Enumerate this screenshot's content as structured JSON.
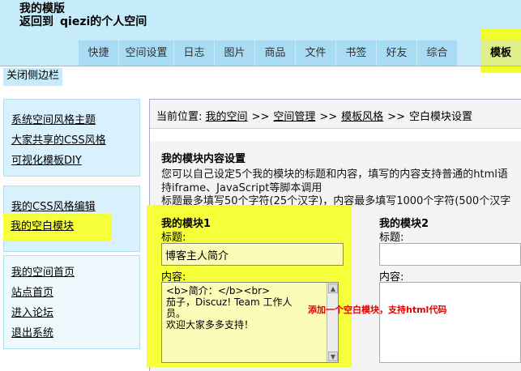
{
  "header": {
    "title": "我的模版",
    "back_prefix": "返回到",
    "back_user": "qiezi的个人空间"
  },
  "tabs": [
    {
      "label": "快捷",
      "width": 50
    },
    {
      "label": "空间设置",
      "width": 68
    },
    {
      "label": "日志",
      "width": 50
    },
    {
      "label": "图片",
      "width": 50
    },
    {
      "label": "商品",
      "width": 50
    },
    {
      "label": "文件",
      "width": 50
    },
    {
      "label": "书签",
      "width": 50
    },
    {
      "label": "好友",
      "width": 50
    },
    {
      "label": "综合",
      "width": 50
    }
  ],
  "active_tab": "模板",
  "close_sidebar": "关闭侧边栏",
  "sidebar": {
    "group1": [
      "系统空间风格主题",
      "大家共享的CSS风格",
      "可视化模板DIY"
    ],
    "group2": [
      "我的CSS风格编辑",
      "我的空白模块"
    ],
    "group3": [
      "我的空间首页",
      "站点首页",
      "进入论坛",
      "退出系统"
    ]
  },
  "breadcrumb": {
    "prefix": "当前位置:",
    "items": [
      "我的空间",
      "空间管理",
      "模板风格"
    ],
    "current": "空白模块设置",
    "sep": ">>"
  },
  "content": {
    "title": "我的模块内容设置",
    "desc1": "您可以自己设定5个我的模块的标题和内容，填写的内容支持普通的html语",
    "desc2": "持iframe、JavaScript等脚本调用",
    "desc3": "标题最多填写50个字符(25个汉字)，内容最多填写1000个字符(500个汉字",
    "module1": {
      "title": "我的模块1",
      "title_label": "标题:",
      "title_value": "博客主人简介",
      "content_label": "内容:",
      "content_line1": "<b>简介：</b><br>",
      "content_line2": "茄子，Discuz! Team 工作人",
      "content_line3": "员。",
      "content_line4": "欢迎大家多多支持！"
    },
    "module2": {
      "title": "我的模块2",
      "title_label": "标题:",
      "content_label": "内容:"
    },
    "annotation": "添加一个空白模块，支持html代码"
  },
  "colors": {
    "header_bg": "#c6ebfb",
    "tab_bg": "#a8dcf4",
    "highlight": "#f5ff3a",
    "annotation": "#e00000"
  }
}
